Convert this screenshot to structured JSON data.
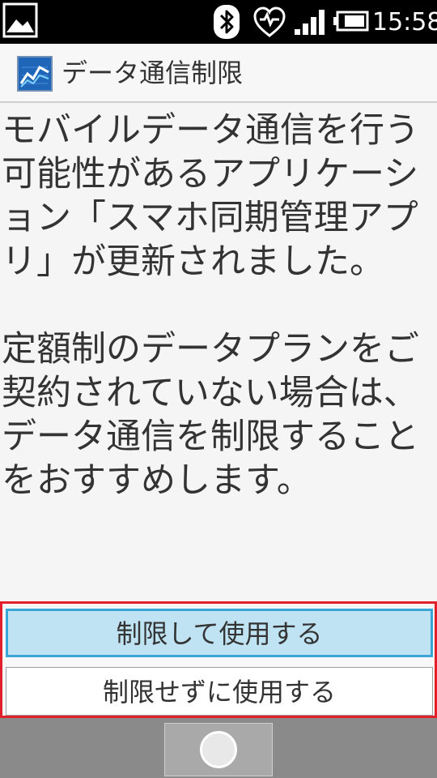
{
  "status_bar": {
    "time": "15:58",
    "icons": [
      "gallery-notification-icon",
      "bluetooth-icon",
      "health-heart-icon",
      "signal-strength-icon",
      "battery-icon"
    ]
  },
  "header": {
    "title": "データ通信制限",
    "icon": "data-usage-chart-icon"
  },
  "message": {
    "paragraph_1": "モバイルデータ通信を行う\n可能性があるアプリケーシ\nョン「スマホ同期管理アプ\nリ」が更新されました。",
    "paragraph_2": "定額制のデータプランをご\n契約されていない場合は、\nデータ通信を制限すること\nをおすすめします。"
  },
  "buttons": {
    "restrict_label": "制限して使用する",
    "no_restrict_label": "制限せずに使用する"
  },
  "colors": {
    "highlight_border": "#e2202c",
    "primary_button_bg": "#bfe3f2",
    "primary_button_border": "#3aa6d8"
  }
}
